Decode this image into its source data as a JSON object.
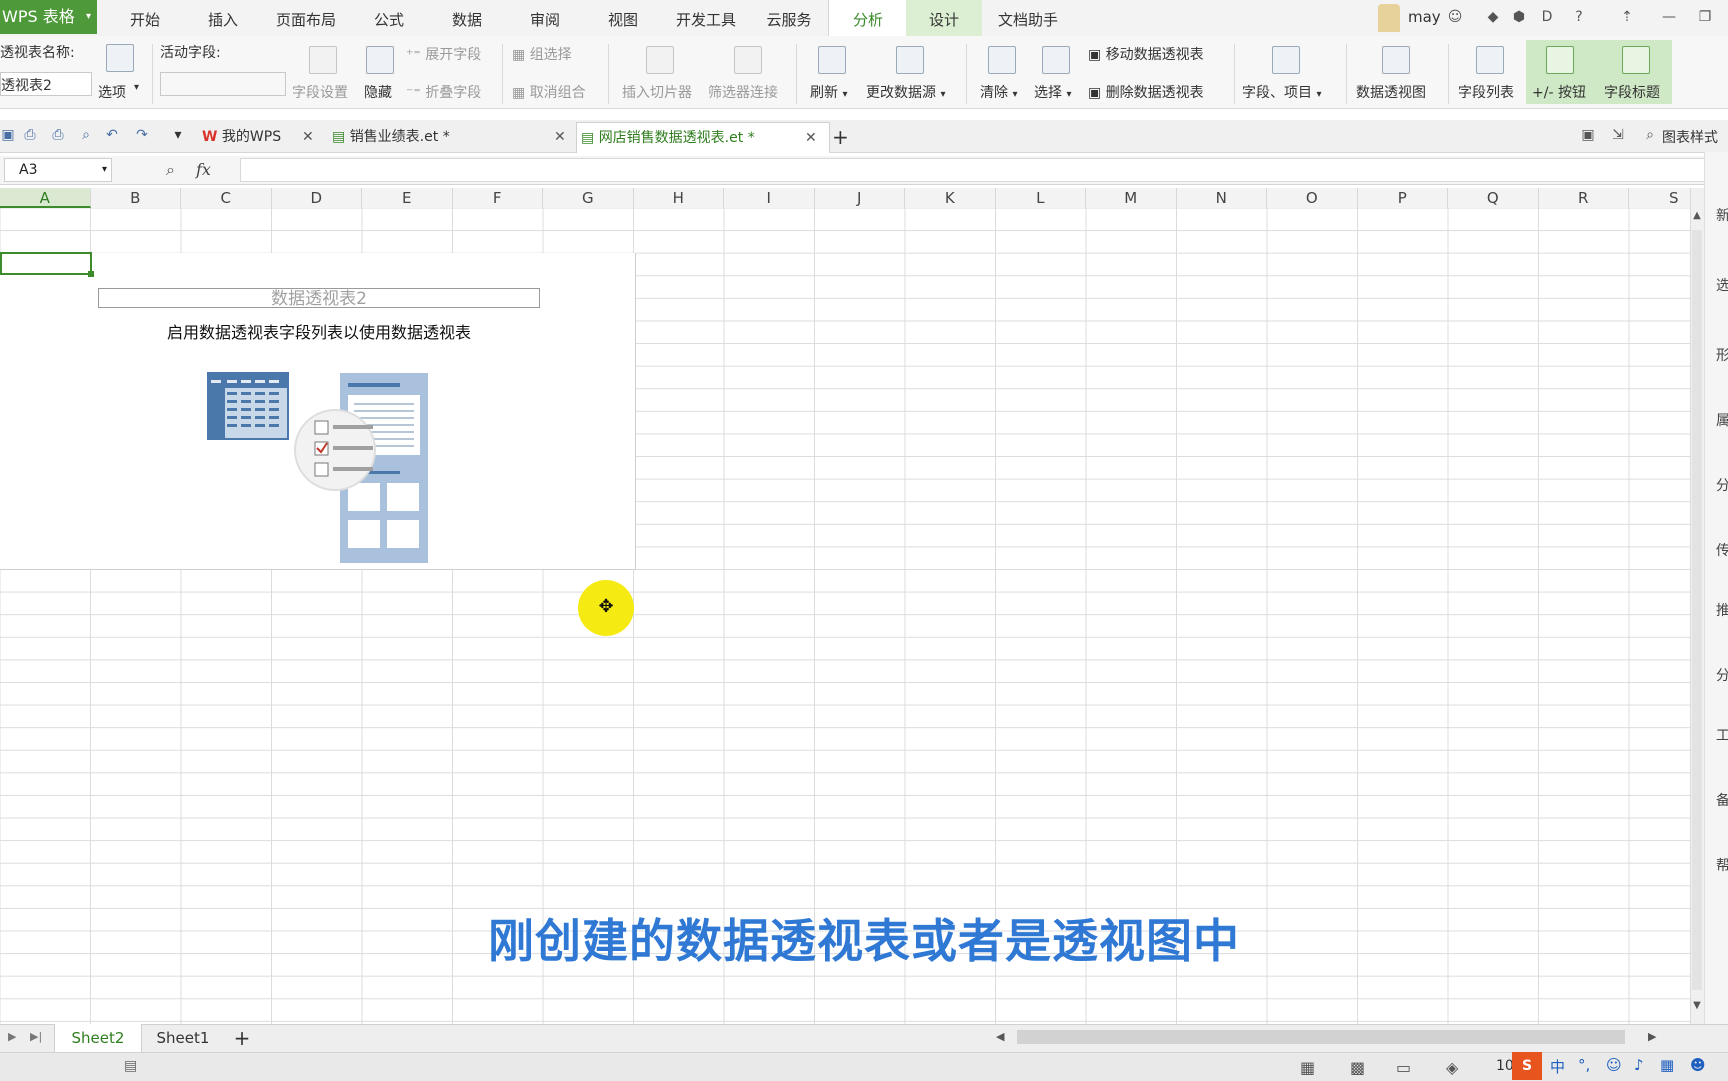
{
  "app": {
    "name": "WPS 表格"
  },
  "menu": {
    "tabs": [
      "开始",
      "插入",
      "页面布局",
      "公式",
      "数据",
      "审阅",
      "视图",
      "开发工具",
      "云服务",
      "分析",
      "设计",
      "文档助手"
    ],
    "active_tab": "分析"
  },
  "account": {
    "name": "may"
  },
  "ribbon": {
    "pivot_name_label": "透视表名称:",
    "pivot_name_value": "透视表2",
    "options_label": "选项",
    "active_field_label": "活动字段:",
    "field_settings": "字段设置",
    "hide": "隐藏",
    "expand_field": "展开字段",
    "collapse_field": "折叠字段",
    "group_selection": "组选择",
    "ungroup": "取消组合",
    "insert_slicer": "插入切片器",
    "filter_connections": "筛选器连接",
    "refresh": "刷新",
    "change_source": "更改数据源",
    "clear": "清除",
    "select": "选择",
    "move_pivot": "移动数据透视表",
    "delete_pivot": "删除数据透视表",
    "fields_items": "字段、项目",
    "pivot_chart": "数据透视图",
    "field_list": "字段列表",
    "plus_minus_buttons": "+/- 按钮",
    "field_headers": "字段标题"
  },
  "doc_tabs": [
    {
      "label": "我的WPS",
      "active": false
    },
    {
      "label": "销售业绩表.et *",
      "active": false
    },
    {
      "label": "网店销售数据透视表.et *",
      "active": true
    }
  ],
  "chart_style": "图表样式",
  "formula_bar": {
    "cell_ref": "A3",
    "fx": "fx"
  },
  "columns": [
    "A",
    "B",
    "C",
    "D",
    "E",
    "F",
    "G",
    "H",
    "I",
    "J",
    "K",
    "L",
    "M",
    "N",
    "O",
    "P",
    "Q",
    "R",
    "S"
  ],
  "selected_column": "A",
  "pivot": {
    "title": "数据透视表2",
    "hint": "启用数据透视表字段列表以使用数据透视表"
  },
  "sheets": [
    {
      "label": "Sheet2",
      "active": true
    },
    {
      "label": "Sheet1",
      "active": false
    }
  ],
  "side_panel": [
    "新",
    "选",
    "形",
    "属",
    "分",
    "传",
    "推",
    "分",
    "工",
    "备",
    "帮"
  ],
  "status": {
    "zoom": "10"
  },
  "subtitle": "刚创建的数据透视表或者是透视图中",
  "colors": {
    "accent": "#4e9a3a",
    "subtitle": "#2f78d4",
    "cursor": "#f5ea12"
  }
}
